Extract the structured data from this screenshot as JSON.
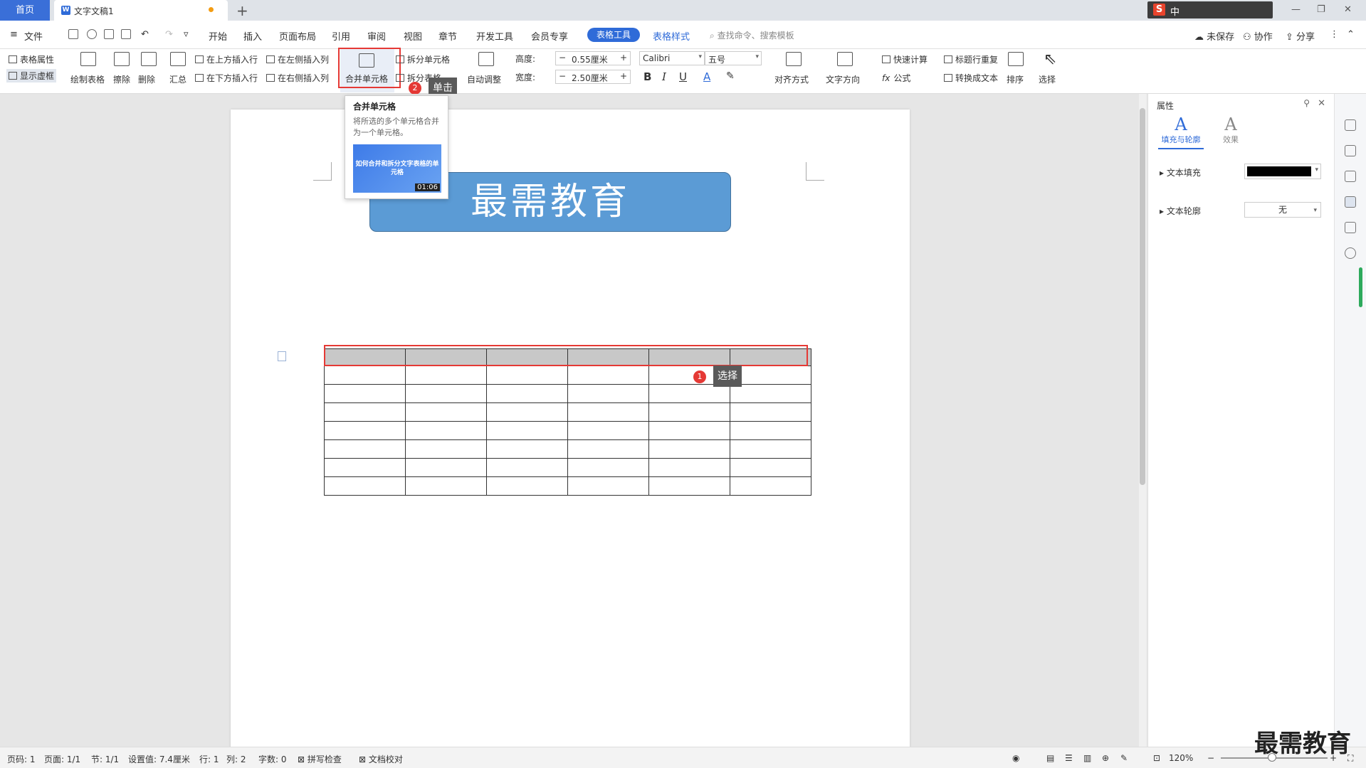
{
  "tabs": {
    "home": "首页",
    "document": "文字文稿1",
    "new_tab": "+"
  },
  "tray": {
    "logo": "S",
    "ime": "中"
  },
  "menu": {
    "file": "文件",
    "items": [
      "开始",
      "插入",
      "页面布局",
      "引用",
      "审阅",
      "视图",
      "章节",
      "开发工具",
      "会员专享"
    ],
    "active": "表格工具",
    "table_style": "表格样式",
    "search": "查找命令、搜索模板",
    "unsaved": "未保存",
    "collaborate": "协作",
    "share": "分享"
  },
  "ribbon": {
    "table_props": "表格属性",
    "show_gridlines": "显示虚框",
    "draw_table": "绘制表格",
    "erase": "擦除",
    "delete": "删除",
    "summary": "汇总",
    "insert_above": "在上方插入行",
    "insert_below": "在下方插入行",
    "insert_left": "在左侧插入列",
    "insert_right": "在右侧插入列",
    "merge_cells": "合并单元格",
    "split_cells": "拆分单元格",
    "split_table": "拆分表格",
    "auto_fit": "自动调整",
    "height_label": "高度:",
    "height_value": "0.55厘米",
    "width_label": "宽度:",
    "width_value": "2.50厘米",
    "font_name": "Calibri",
    "font_size": "五号",
    "align": "对齐方式",
    "text_direction": "文字方向",
    "quick_calc": "快速计算",
    "repeat_header": "标题行重复",
    "formula": "公式",
    "to_text": "转换成文本",
    "sort": "排序",
    "select": "选择"
  },
  "tooltip": {
    "title": "合并单元格",
    "desc": "将所选的多个单元格合并为一个单元格。",
    "video_title": "如何合并和拆分文字表格的单元格",
    "video_time": "01:06"
  },
  "callouts": [
    {
      "num": "1",
      "text": "选择"
    },
    {
      "num": "2",
      "text": "单击"
    }
  ],
  "document": {
    "banner": "最需教育",
    "table": {
      "rows": 8,
      "cols": 6,
      "selected_row": 1
    }
  },
  "panel": {
    "header": "属性",
    "tab_fill": "填充与轮廓",
    "tab_effect": "效果",
    "text_fill": "文本填充",
    "text_fill_color": "#000000",
    "text_outline": "文本轮廓",
    "text_outline_value": "无"
  },
  "status": {
    "page_num": "页码: 1",
    "pages": "页面: 1/1",
    "section": "节: 1/1",
    "setting": "设置值: 7.4厘米",
    "row": "行: 1",
    "col": "列: 2",
    "words": "字数: 0",
    "spell": "拼写检查",
    "proof": "文档校对",
    "zoom": "120%",
    "watermark": "最需教育"
  },
  "colors": {
    "accent": "#2f6bd8",
    "highlight": "#e53935",
    "banner": "#5b9bd5"
  }
}
